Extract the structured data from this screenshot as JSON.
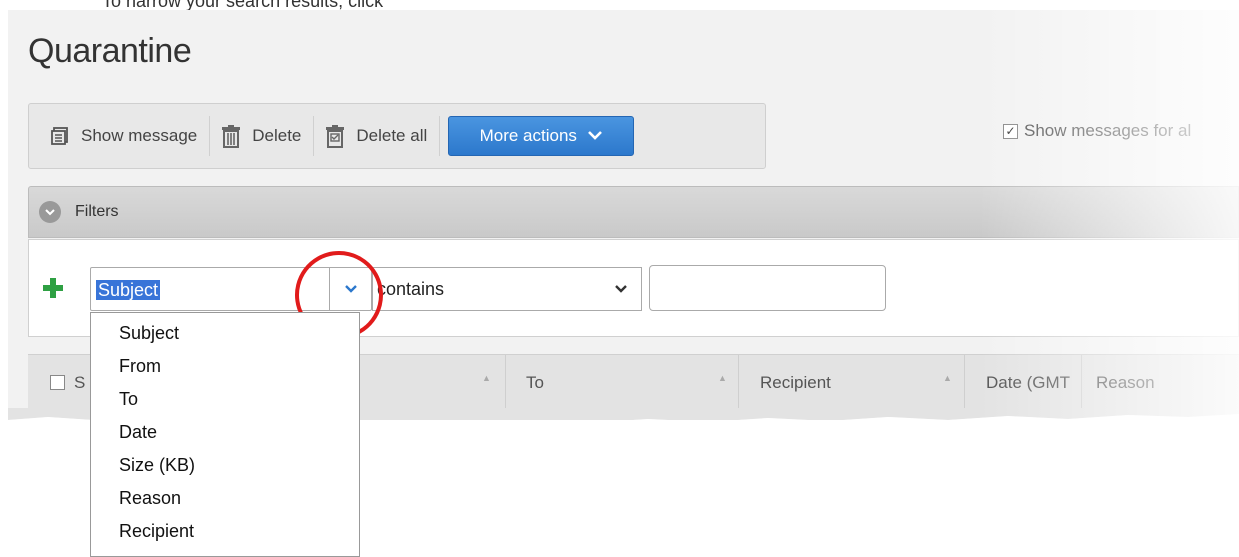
{
  "doc_intro_text": "To narrow your search results, click",
  "page_title": "Quarantine",
  "toolbar": {
    "show_message": "Show message",
    "delete": "Delete",
    "delete_all": "Delete all",
    "more_actions": "More actions"
  },
  "show_messages_checkbox": {
    "label": "Show messages for al",
    "checked": true
  },
  "filters": {
    "label": "Filters",
    "field_select_value": "Subject",
    "operator_select_value": "contains",
    "value_input": "",
    "field_options": [
      "Subject",
      "From",
      "To",
      "Date",
      "Size (KB)",
      "Reason",
      "Recipient"
    ]
  },
  "table": {
    "columns": [
      "S",
      "To",
      "Recipient",
      "Date (GMT",
      "Reason"
    ]
  },
  "colors": {
    "accent_blue": "#2c78cc",
    "selection_blue": "#3874d8",
    "add_green": "#2ea043",
    "highlight_red": "#e11b1b"
  },
  "icons": [
    "show-message-icon",
    "trash-icon",
    "trash-all-icon",
    "chevron-down-icon",
    "plus-icon"
  ]
}
